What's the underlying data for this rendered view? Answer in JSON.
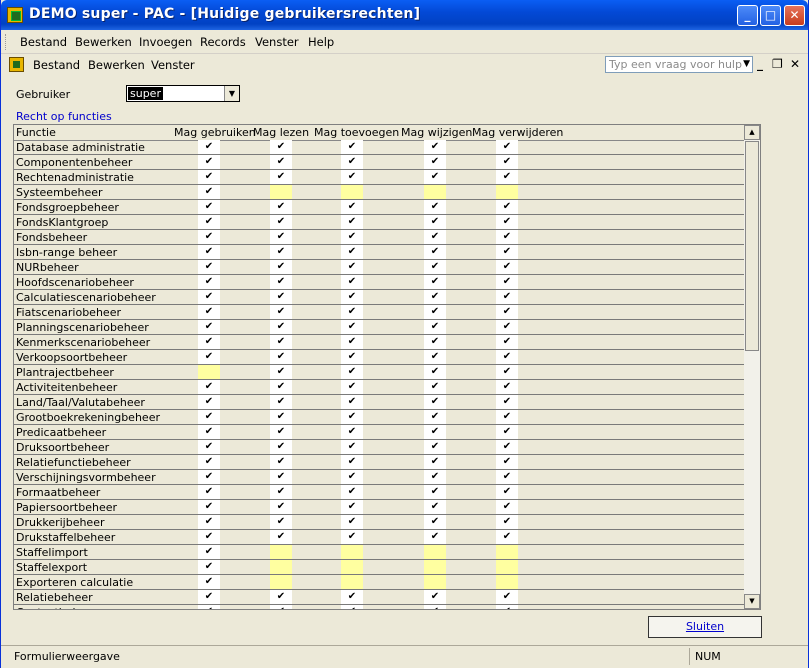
{
  "window": {
    "title": "DEMO super - PAC - [Huidige gebruikersrechten]",
    "controls": {
      "minimize": "_",
      "maximize": "□",
      "close": "✕"
    }
  },
  "menubar": {
    "items": [
      "Bestand",
      "Bewerken",
      "Invoegen",
      "Records",
      "Venster",
      "Help"
    ]
  },
  "toolbar": {
    "items": [
      "Bestand",
      "Bewerken",
      "Venster"
    ],
    "help_placeholder": "Typ een vraag voor hulp",
    "mdi_controls": {
      "minimize": "_",
      "restore": "❐",
      "close": "✕"
    }
  },
  "form": {
    "user_label": "Gebruiker",
    "user_value": "super",
    "section_label": "Recht op functies",
    "columns": [
      "Functie",
      "Mag gebruiken",
      "Mag lezen",
      "Mag toevoegen",
      "Mag wijzigen",
      "Mag verwijderen"
    ],
    "check_glyph": "✔",
    "rows": [
      {
        "name": "Database administratie",
        "rights": [
          true,
          true,
          true,
          true,
          true
        ]
      },
      {
        "name": "Componentenbeheer",
        "rights": [
          true,
          true,
          true,
          true,
          true
        ]
      },
      {
        "name": "Rechtenadministratie",
        "rights": [
          true,
          true,
          true,
          true,
          true
        ]
      },
      {
        "name": "Systeembeheer",
        "rights": [
          true,
          false,
          false,
          false,
          false
        ]
      },
      {
        "name": "Fondsgroepbeheer",
        "rights": [
          true,
          true,
          true,
          true,
          true
        ]
      },
      {
        "name": "FondsKlantgroep",
        "rights": [
          true,
          true,
          true,
          true,
          true
        ]
      },
      {
        "name": "Fondsbeheer",
        "rights": [
          true,
          true,
          true,
          true,
          true
        ]
      },
      {
        "name": "Isbn-range beheer",
        "rights": [
          true,
          true,
          true,
          true,
          true
        ]
      },
      {
        "name": "NURbeheer",
        "rights": [
          true,
          true,
          true,
          true,
          true
        ]
      },
      {
        "name": "Hoofdscenariobeheer",
        "rights": [
          true,
          true,
          true,
          true,
          true
        ]
      },
      {
        "name": "Calculatiescenariobeheer",
        "rights": [
          true,
          true,
          true,
          true,
          true
        ]
      },
      {
        "name": "Fiatscenariobeheer",
        "rights": [
          true,
          true,
          true,
          true,
          true
        ]
      },
      {
        "name": "Planningscenariobeheer",
        "rights": [
          true,
          true,
          true,
          true,
          true
        ]
      },
      {
        "name": "Kenmerkscenariobeheer",
        "rights": [
          true,
          true,
          true,
          true,
          true
        ]
      },
      {
        "name": "Verkoopsoortbeheer",
        "rights": [
          true,
          true,
          true,
          true,
          true
        ]
      },
      {
        "name": "Plantrajectbeheer",
        "rights": [
          false,
          true,
          true,
          true,
          true
        ]
      },
      {
        "name": "Activiteitenbeheer",
        "rights": [
          true,
          true,
          true,
          true,
          true
        ]
      },
      {
        "name": "Land/Taal/Valutabeheer",
        "rights": [
          true,
          true,
          true,
          true,
          true
        ]
      },
      {
        "name": "Grootboekrekeningbeheer",
        "rights": [
          true,
          true,
          true,
          true,
          true
        ]
      },
      {
        "name": "Predicaatbeheer",
        "rights": [
          true,
          true,
          true,
          true,
          true
        ]
      },
      {
        "name": "Druksoortbeheer",
        "rights": [
          true,
          true,
          true,
          true,
          true
        ]
      },
      {
        "name": "Relatiefunctiebeheer",
        "rights": [
          true,
          true,
          true,
          true,
          true
        ]
      },
      {
        "name": "Verschijningsvormbeheer",
        "rights": [
          true,
          true,
          true,
          true,
          true
        ]
      },
      {
        "name": "Formaatbeheer",
        "rights": [
          true,
          true,
          true,
          true,
          true
        ]
      },
      {
        "name": "Papiersoortbeheer",
        "rights": [
          true,
          true,
          true,
          true,
          true
        ]
      },
      {
        "name": "Drukkerijbeheer",
        "rights": [
          true,
          true,
          true,
          true,
          true
        ]
      },
      {
        "name": "Drukstaffelbeheer",
        "rights": [
          true,
          true,
          true,
          true,
          true
        ]
      },
      {
        "name": "Staffelimport",
        "rights": [
          true,
          false,
          false,
          false,
          false
        ]
      },
      {
        "name": "Staffelexport",
        "rights": [
          true,
          false,
          false,
          false,
          false
        ]
      },
      {
        "name": "Exporteren calculatie",
        "rights": [
          true,
          false,
          false,
          false,
          false
        ]
      },
      {
        "name": "Relatiebeheer",
        "rights": [
          true,
          true,
          true,
          true,
          true
        ]
      },
      {
        "name": "Contactbeheer",
        "rights": [
          true,
          true,
          true,
          true,
          true
        ]
      }
    ],
    "close_button": "Sluiten"
  },
  "statusbar": {
    "left": "Formulierweergave",
    "num": "NUM"
  },
  "colors": {
    "title_bar": "#0349d6",
    "link_blue": "#0000cc",
    "denied_cell": "#ffffa0",
    "face": "#ece9d8"
  }
}
